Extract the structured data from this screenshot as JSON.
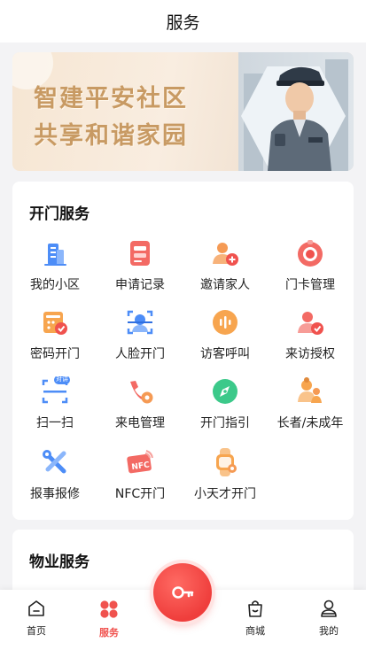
{
  "header": {
    "title": "服务"
  },
  "banner": {
    "line1": "智建平安社区",
    "line2": "共享和谐家园"
  },
  "door_service": {
    "title": "开门服务",
    "items": [
      {
        "label": "我的小区",
        "icon": "building-icon"
      },
      {
        "label": "申请记录",
        "icon": "record-icon"
      },
      {
        "label": "邀请家人",
        "icon": "invite-family-icon"
      },
      {
        "label": "门卡管理",
        "icon": "door-card-icon"
      },
      {
        "label": "密码开门",
        "icon": "password-icon"
      },
      {
        "label": "人脸开门",
        "icon": "face-scan-icon"
      },
      {
        "label": "访客呼叫",
        "icon": "visitor-call-icon"
      },
      {
        "label": "来访授权",
        "icon": "visit-authorize-icon"
      },
      {
        "label": "扫一扫",
        "icon": "scan-icon",
        "badge": "对讲"
      },
      {
        "label": "来电管理",
        "icon": "call-manage-icon"
      },
      {
        "label": "开门指引",
        "icon": "compass-icon"
      },
      {
        "label": "长者/未成年",
        "icon": "elder-child-icon"
      },
      {
        "label": "报事报修",
        "icon": "repair-icon"
      },
      {
        "label": "NFC开门",
        "icon": "nfc-icon"
      },
      {
        "label": "小天才开门",
        "icon": "smartwatch-icon"
      }
    ]
  },
  "property_service": {
    "title": "物业服务"
  },
  "tabbar": {
    "items": [
      {
        "label": "首页",
        "icon": "home-icon"
      },
      {
        "label": "服务",
        "icon": "service-icon",
        "active": true
      },
      {
        "label": "",
        "icon": "key-icon"
      },
      {
        "label": "商城",
        "icon": "shop-bag-icon"
      },
      {
        "label": "我的",
        "icon": "profile-icon"
      }
    ]
  },
  "colors": {
    "accent": "#f0524e",
    "banner_text": "#c89a63",
    "icon_blue": "#4d8df7",
    "icon_orange": "#f9a04b"
  }
}
